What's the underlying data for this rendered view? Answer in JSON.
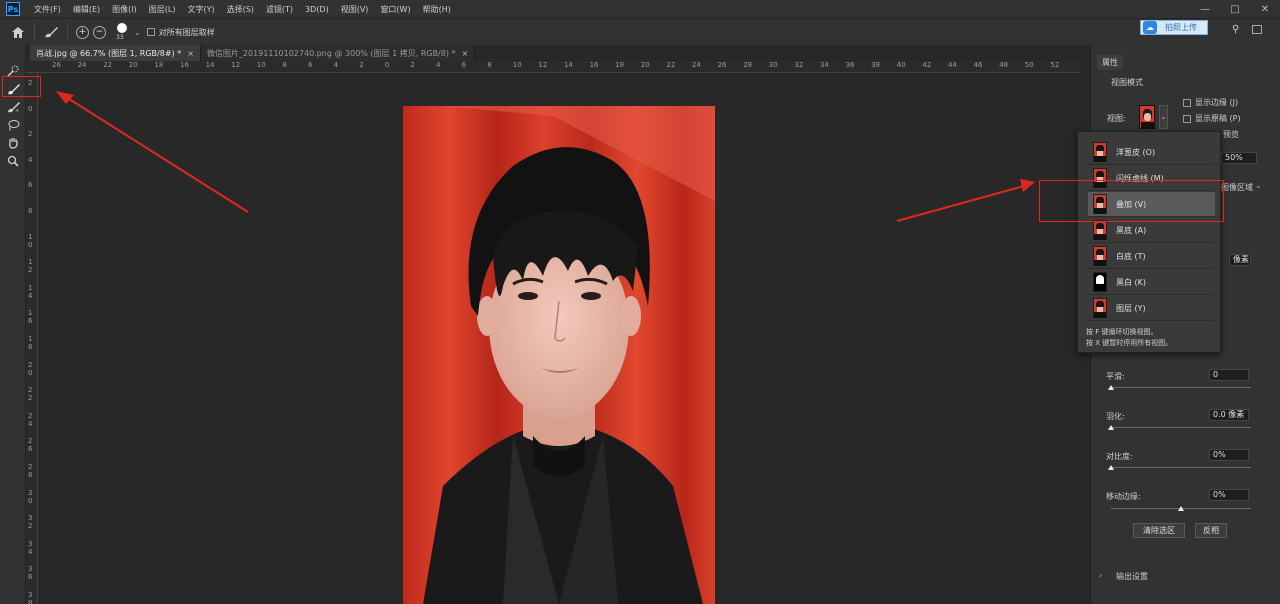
{
  "menubar": {
    "logo": "Ps",
    "items": [
      "文件(F)",
      "编辑(E)",
      "图像(I)",
      "图层(L)",
      "文字(Y)",
      "选择(S)",
      "滤镜(T)",
      "3D(D)",
      "视图(V)",
      "窗口(W)",
      "帮助(H)"
    ],
    "window_controls": [
      "—",
      "□",
      "✕"
    ]
  },
  "optbar": {
    "brush_size": "33",
    "sample_all_layers": "对所有图层取样",
    "upload_label": "拍照上传"
  },
  "tabs": [
    {
      "title": "肖战.jpg @ 66.7% (图层 1, RGB/8#) *",
      "active": true
    },
    {
      "title": "微信图片_20191110102740.png @ 300% (图层 1 拷贝, RGB/8) *",
      "active": false
    }
  ],
  "ruler": {
    "top": [
      "26",
      "24",
      "22",
      "20",
      "18",
      "16",
      "14",
      "12",
      "10",
      "8",
      "6",
      "4",
      "2",
      "0",
      "2",
      "4",
      "6",
      "8",
      "10",
      "12",
      "14",
      "16",
      "18",
      "20",
      "22",
      "24",
      "26",
      "28",
      "30",
      "32",
      "34",
      "36",
      "38",
      "40",
      "42",
      "44",
      "46",
      "48",
      "50",
      "52"
    ],
    "left": [
      "2",
      "0",
      "2",
      "4",
      "6",
      "8",
      "1 0",
      "1 2",
      "1 4",
      "1 6",
      "1 8",
      "2 0",
      "2 2",
      "2 4",
      "2 6",
      "2 8",
      "3 0",
      "3 2",
      "3 4",
      "3 6",
      "3 8"
    ]
  },
  "panel": {
    "tab": "属性",
    "view_mode_section": "视图模式",
    "view_label": "视图:",
    "show_edge": "显示边缘 (J)",
    "show_original": "显示原稿 (P)",
    "partial_right": "预览",
    "opacity_value": "50%",
    "area_value": "图像区域",
    "pixels_value": "像素",
    "smooth_label": "平滑:",
    "smooth_value": "0",
    "feather_label": "羽化:",
    "feather_value": "0.0 像素",
    "contrast_label": "对比度:",
    "contrast_value": "0%",
    "shift_edge_label": "移动边缘:",
    "shift_edge_value": "0%",
    "clear_selection": "清除选区",
    "invert": "反相",
    "output_settings": "输出设置",
    "smooth_level": 0,
    "feather_level": 0,
    "contrast_level": 0,
    "shift_edge_level": 0.5
  },
  "popup": {
    "items": [
      {
        "label": "洋葱皮 (O)",
        "selected": false
      },
      {
        "label": "闪烁虚线 (M)",
        "selected": false
      },
      {
        "label": "叠加 (V)",
        "selected": true
      },
      {
        "label": "黑底 (A)",
        "selected": false
      },
      {
        "label": "白底 (T)",
        "selected": false
      },
      {
        "label": "黑白 (K)",
        "selected": false
      },
      {
        "label": "图层 (Y)",
        "selected": false
      }
    ],
    "hint1": "按 F 键循环切换视图。",
    "hint2": "按 X 键暂时停用所有视图。"
  },
  "colors": {
    "annotation": "#e3261c",
    "backdrop": "#d43a2a"
  }
}
